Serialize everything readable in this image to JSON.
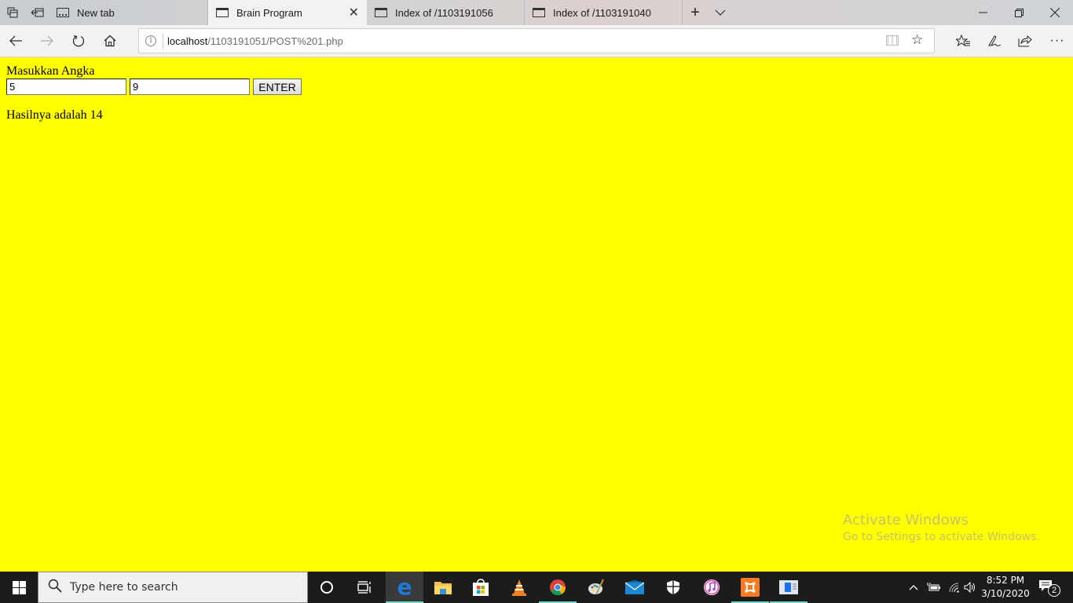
{
  "browser": {
    "tabs": [
      {
        "label": "New tab",
        "active": false,
        "icon": "new-tab-icon"
      },
      {
        "label": "Brain Program",
        "active": true,
        "icon": "page-icon"
      },
      {
        "label": "Index of /1103191056",
        "active": false,
        "icon": "page-icon"
      },
      {
        "label": "Index of /1103191040",
        "active": false,
        "icon": "page-icon"
      }
    ],
    "address": {
      "host": "localhost",
      "path": "/1103191051/POST%201.php"
    },
    "window_controls": [
      "minimize",
      "restore",
      "close"
    ]
  },
  "page": {
    "label": "Masukkan Angka",
    "input1_value": "5",
    "input2_value": "9",
    "enter_label": "ENTER",
    "result_text": "Hasilnya adalah 14",
    "background_color": "#ffff00"
  },
  "watermark": {
    "title": "Activate Windows",
    "subtitle": "Go to Settings to activate Windows."
  },
  "taskbar": {
    "search_placeholder": "Type here to search",
    "apps": [
      "cortana",
      "task-view",
      "edge",
      "file-explorer",
      "store",
      "vlc",
      "chrome",
      "paint",
      "mail",
      "security",
      "itunes",
      "xampp",
      "app-window"
    ],
    "time": "8:52 PM",
    "date": "3/10/2020",
    "notifications": "2"
  }
}
